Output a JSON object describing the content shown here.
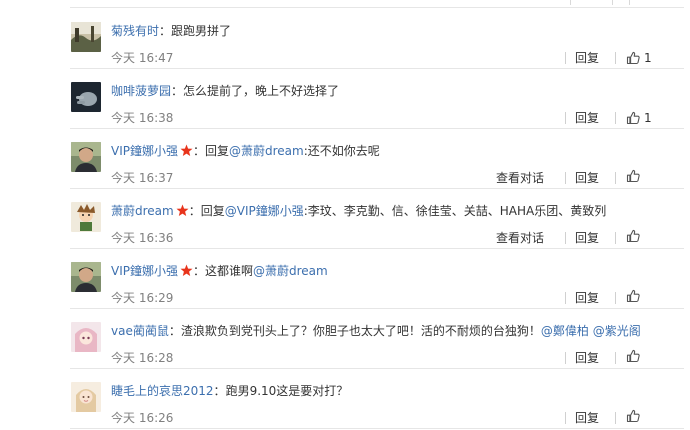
{
  "comments": [
    {
      "user": "菊残有时",
      "vip": false,
      "prefix": "：",
      "reply_to": "",
      "reply_suffix": "",
      "text": "跟跑男拼了",
      "mentions": [],
      "time": "今天 16:47",
      "view_conversation": "",
      "reply": "回复",
      "likes": "1",
      "avatar_icon": "landscape-avatar"
    },
    {
      "user": "咖啡菠萝园",
      "vip": false,
      "prefix": "：",
      "reply_to": "",
      "reply_suffix": "",
      "text": "怎么提前了，晚上不好选择了",
      "mentions": [],
      "time": "今天 16:38",
      "view_conversation": "",
      "reply": "回复",
      "likes": "1",
      "avatar_icon": "hand-avatar"
    },
    {
      "user": "VIP鐘娜小强",
      "vip": true,
      "prefix": "：回复",
      "reply_to": "@萧蔚dream",
      "reply_suffix": ":还不如你去呢",
      "text": "",
      "mentions": [],
      "time": "今天 16:37",
      "view_conversation": "查看对话",
      "reply": "回复",
      "likes": "",
      "avatar_icon": "man-avatar"
    },
    {
      "user": "萧蔚dream",
      "vip": true,
      "prefix": "：回复",
      "reply_to": "@VIP鐘娜小强",
      "reply_suffix": ":李玟、李克勤、信、徐佳莹、关喆、HAHA乐团、黄致列",
      "text": "",
      "mentions": [],
      "time": "今天 16:36",
      "view_conversation": "查看对话",
      "reply": "回复",
      "likes": "",
      "avatar_icon": "cartoon-avatar"
    },
    {
      "user": "VIP鐘娜小强",
      "vip": true,
      "prefix": "：这都谁啊",
      "reply_to": "@萧蔚dream",
      "reply_suffix": "",
      "text": "",
      "mentions": [],
      "time": "今天 16:29",
      "view_conversation": "",
      "reply": "回复",
      "likes": "",
      "avatar_icon": "man-avatar"
    },
    {
      "user": "vae蔺蔺鼠",
      "vip": false,
      "prefix": "：",
      "reply_to": "",
      "reply_suffix": "",
      "text": "渣浪欺负到党刊头上了？你胆子也太大了吧！活的不耐烦的台独狗！",
      "mentions": [
        "@鄭偉柏",
        "@紫光阁"
      ],
      "time": "今天 16:28",
      "view_conversation": "",
      "reply": "回复",
      "likes": "",
      "avatar_icon": "anime-avatar"
    },
    {
      "user": "睫毛上的哀思2012",
      "vip": false,
      "prefix": "：",
      "reply_to": "",
      "reply_suffix": "",
      "text": "跑男9.10这是要对打？",
      "mentions": [],
      "time": "今天 16:26",
      "view_conversation": "",
      "reply": "回复",
      "likes": "",
      "avatar_icon": "girl-avatar"
    }
  ],
  "colors": {
    "link": "#3c6fae",
    "text": "#333333",
    "time": "#808080",
    "divider": "#e6e6e6",
    "vip_star": "#e8341c"
  }
}
